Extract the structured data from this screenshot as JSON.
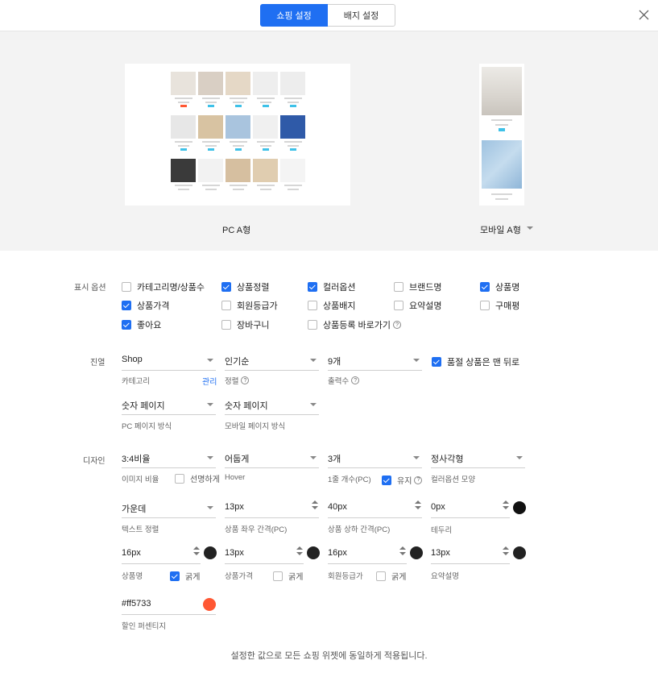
{
  "tabs": [
    {
      "label": "쇼핑 설정",
      "active": true
    },
    {
      "label": "배지 설정",
      "active": false
    }
  ],
  "preview": {
    "pc_label": "PC A형",
    "mobile_label": "모바일 A형"
  },
  "display_options": {
    "label": "표시 옵션",
    "items": [
      {
        "label": "카테고리명/상품수",
        "checked": false
      },
      {
        "label": "상품정렬",
        "checked": true
      },
      {
        "label": "컬러옵션",
        "checked": true
      },
      {
        "label": "브랜드명",
        "checked": false
      },
      {
        "label": "상품명",
        "checked": true
      },
      {
        "label": "상품가격",
        "checked": true
      },
      {
        "label": "회원등급가",
        "checked": false
      },
      {
        "label": "상품배지",
        "checked": false
      },
      {
        "label": "요약설명",
        "checked": false
      },
      {
        "label": "구매평",
        "checked": false
      },
      {
        "label": "좋아요",
        "checked": true
      },
      {
        "label": "장바구니",
        "checked": false
      },
      {
        "label": "상품등록 바로가기",
        "checked": false
      }
    ]
  },
  "layout": {
    "label": "진열",
    "category": {
      "value": "Shop",
      "sub": "카테고리",
      "manage": "관리"
    },
    "sort": {
      "value": "인기순",
      "sub": "정렬"
    },
    "count": {
      "value": "9개",
      "sub": "출력수"
    },
    "soldout": {
      "label": "품절 상품은 맨 뒤로",
      "checked": true
    },
    "pc_paging": {
      "value": "숫자 페이지",
      "sub": "PC 페이지 방식"
    },
    "mobile_paging": {
      "value": "숫자 페이지",
      "sub": "모바일 페이지 방식"
    }
  },
  "design": {
    "label": "디자인",
    "ratio": {
      "value": "3:4비율",
      "sub": "이미지 비율",
      "option": "선명하게",
      "checked": false
    },
    "hover": {
      "value": "어둡게",
      "sub": "Hover"
    },
    "per_row": {
      "value": "3개",
      "sub": "1줄 개수(PC)",
      "option": "유지",
      "checked": true
    },
    "color_shape": {
      "value": "정사각형",
      "sub": "컬러옵션 모양"
    },
    "text_align": {
      "value": "가운데",
      "sub": "텍스트 정렬"
    },
    "h_gap": {
      "value": "13px",
      "sub": "상품 좌우 간격(PC)"
    },
    "v_gap": {
      "value": "40px",
      "sub": "상품 상하 간격(PC)"
    },
    "border": {
      "value": "0px",
      "sub": "테두리",
      "color": "#111111"
    },
    "name_size": {
      "value": "16px",
      "sub": "상품명",
      "option": "굵게",
      "checked": true,
      "color": "#222222"
    },
    "price_size": {
      "value": "13px",
      "sub": "상품가격",
      "option": "굵게",
      "checked": false,
      "color": "#222222"
    },
    "member_size": {
      "value": "16px",
      "sub": "회원등급가",
      "option": "굵게",
      "checked": false,
      "color": "#222222"
    },
    "summary_size": {
      "value": "13px",
      "sub": "요약설명",
      "color": "#222222"
    },
    "discount": {
      "value": "#ff5733",
      "sub": "할인 퍼센티지",
      "color": "#ff5733"
    }
  },
  "footer": "설정한 값으로 모든 쇼핑 위젯에 동일하게 적용됩니다.",
  "icons": {
    "close": "close-icon",
    "help": "help-circle-icon",
    "dropdown": "chevron-down-icon",
    "spinner": "spinner-icon"
  }
}
